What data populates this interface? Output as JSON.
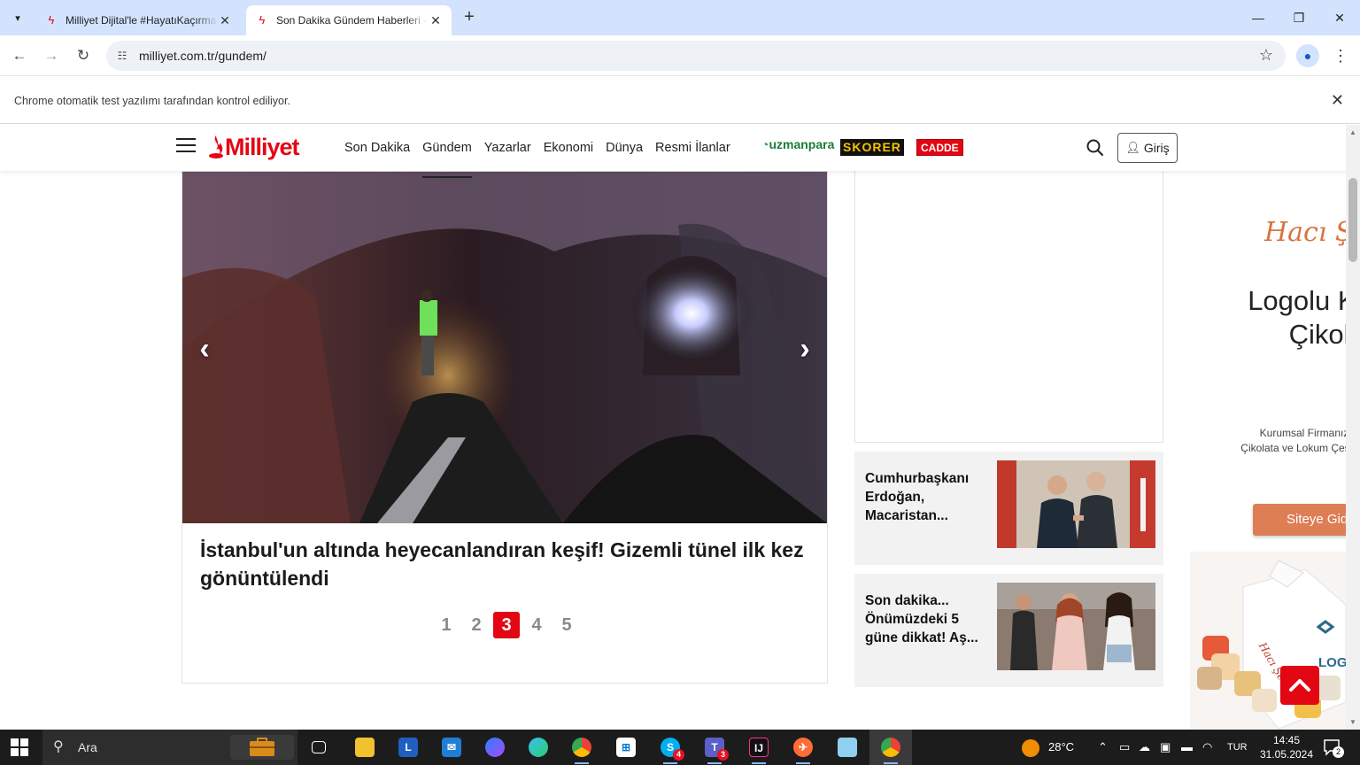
{
  "browser": {
    "tabs": [
      {
        "title": "Milliyet Dijital'le #HayatıKaçırma",
        "active": false
      },
      {
        "title": "Son Dakika Gündem Haberleri - Milliyet",
        "active": true
      }
    ],
    "url": "milliyet.com.tr/gundem/",
    "infobar_message": "Chrome otomatik test yazılımı tarafından kontrol ediliyor."
  },
  "site": {
    "logo": "Milliyet",
    "nav": [
      {
        "label": "Son Dakika",
        "active": false
      },
      {
        "label": "Gündem",
        "active": true
      },
      {
        "label": "Yazarlar",
        "active": false
      },
      {
        "label": "Ekonomi",
        "active": false
      },
      {
        "label": "Dünya",
        "active": false
      },
      {
        "label": "Resmi İlanlar",
        "active": false
      }
    ],
    "partners": {
      "uzmanpara": "uzmanpara",
      "skorer": "SKORER",
      "cadde": "CADDE"
    },
    "login_label": "Giriş"
  },
  "slider": {
    "headline": "İstanbul'un altında heyecanlandıran keşif! Gizemli tünel ilk kez gönüntülendi",
    "pages": [
      "1",
      "2",
      "3",
      "4",
      "5"
    ],
    "current_page": "3"
  },
  "side_news": [
    {
      "text": "Cumhurbaşkanı Erdoğan, Macaristan..."
    },
    {
      "text": "Son dakika... Önümüzdeki 5 güne dikkat! Aş..."
    }
  ],
  "ad": {
    "brand": "Hacı Şe",
    "headline_line1": "Logolu Ku",
    "headline_line2": "Çikolat",
    "sub_line1": "Kurumsal Firmanıza Öze",
    "sub_line2": "Çikolata ve Lokum Çeşitleri",
    "button": "Siteye Gid"
  },
  "taskbar": {
    "search_label": "Ara",
    "weather": "28°C",
    "language": "TUR",
    "time": "14:45",
    "date": "31.05.2024",
    "notification_count": "2",
    "badges": {
      "skype": "4",
      "teams": "3"
    }
  },
  "colors": {
    "brand_red": "#e30613",
    "tab_strip": "#d3e3fd",
    "ad_orange": "#de7e55"
  }
}
